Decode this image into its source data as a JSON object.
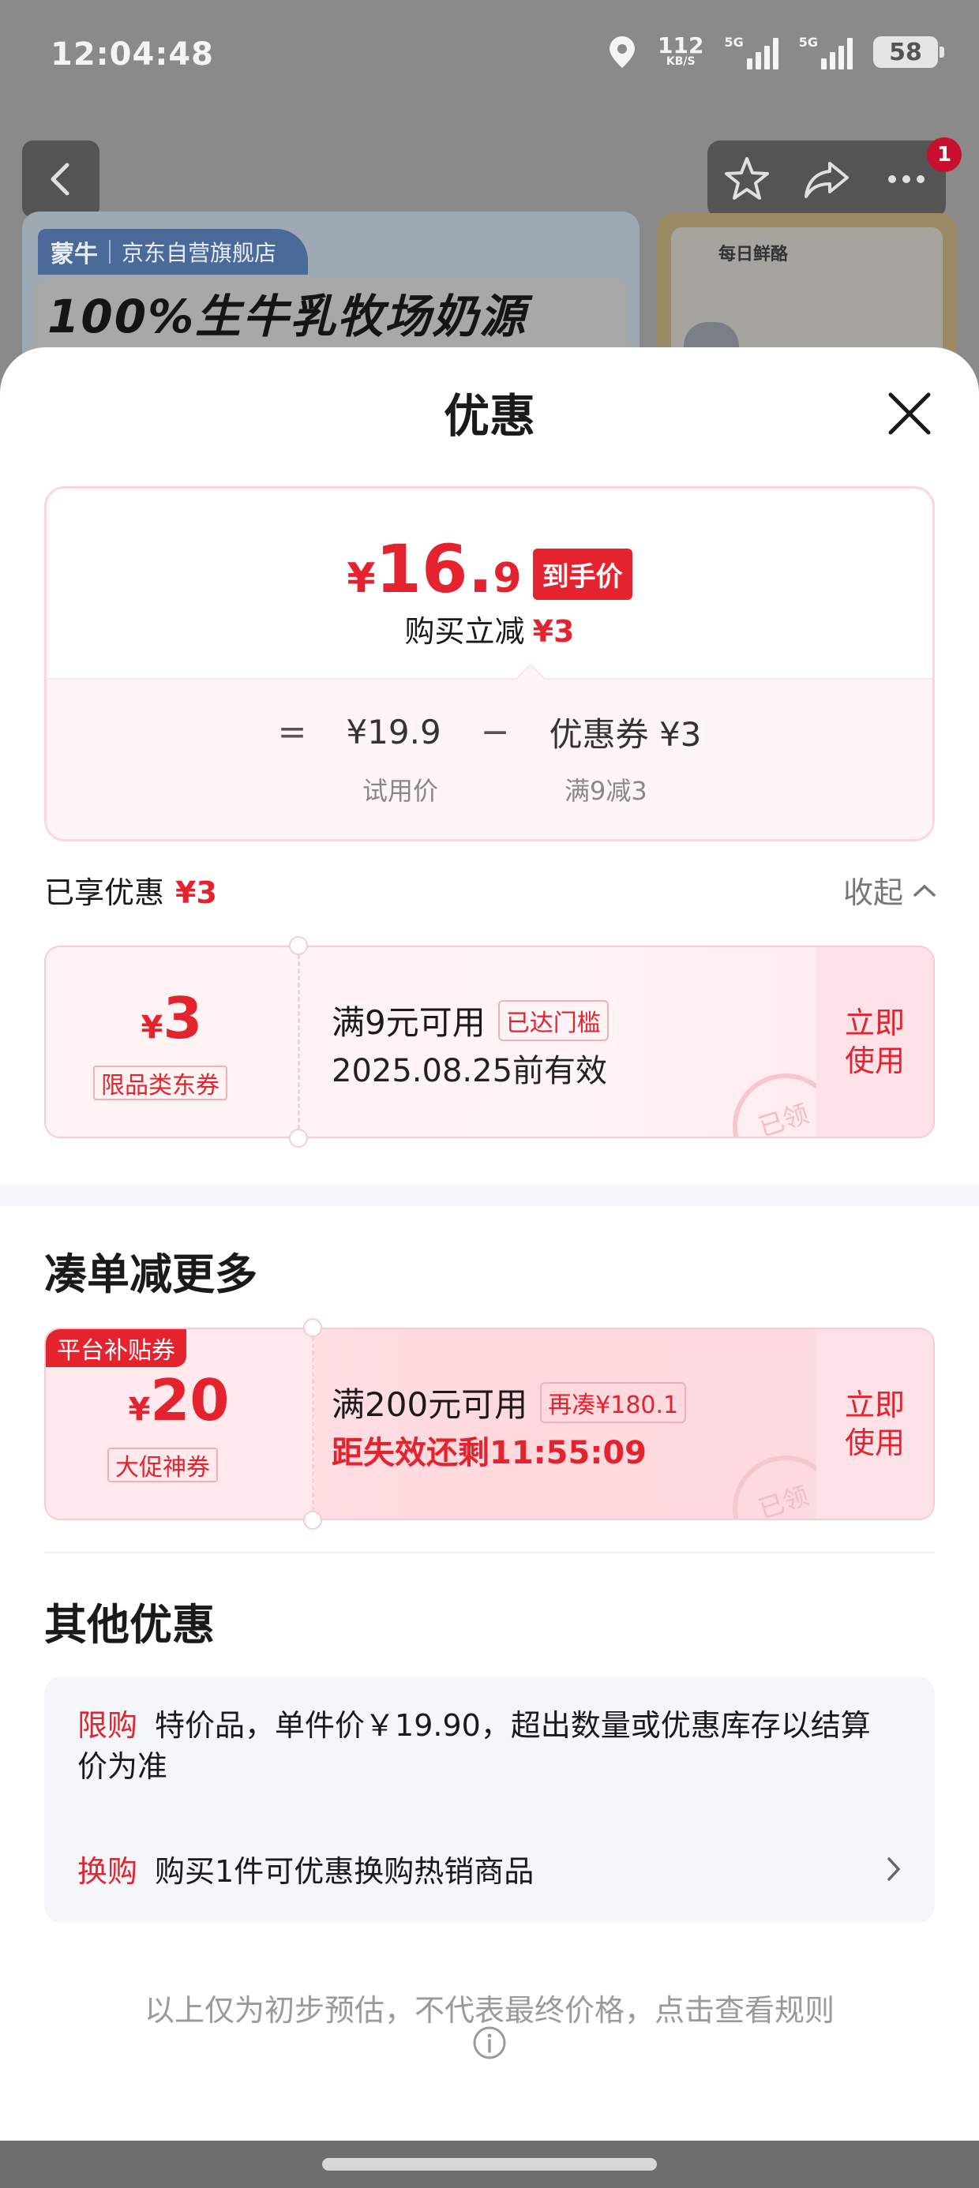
{
  "status_bar": {
    "time": "12:04:48",
    "net_speed": "112",
    "net_unit": "KB/S",
    "sim1": "5G",
    "sim2": "5G",
    "battery": "58"
  },
  "background": {
    "notif_count": "1",
    "banner_brand": "蒙牛",
    "banner_store": "京东自营旗舰店",
    "banner_headline": "100%生牛乳牧场奶源",
    "side_logo": "每日鲜酪"
  },
  "sheet": {
    "title": "优惠",
    "price": {
      "currency": "¥",
      "integer": "16.",
      "decimal": "9",
      "badge": "到手价",
      "sub_label": "购买立减",
      "sub_value": "¥3",
      "eq": "=",
      "trial_price": "¥19.9",
      "minus": "−",
      "coupon_label": "优惠券 ¥3",
      "trial_label": "试用价",
      "coupon_rule": "满9减3"
    },
    "enjoyed": {
      "label": "已享优惠",
      "value": "¥3",
      "collapse": "收起"
    },
    "coupon1": {
      "currency": "¥",
      "amount": "3",
      "type": "限品类东券",
      "condition": "满9元可用",
      "status_tag": "已达门槛",
      "validity": "2025.08.25前有效",
      "use": "立即使用",
      "stamp": "已领"
    },
    "more": {
      "title": "凑单减更多"
    },
    "coupon2": {
      "platform_tag": "平台补贴券",
      "currency": "¥",
      "amount": "20",
      "type": "大促神券",
      "condition": "满200元可用",
      "extra_tag": "再凑¥180.1",
      "countdown": "距失效还剩11:55:09",
      "use": "立即使用",
      "stamp": "已领"
    },
    "other": {
      "title": "其他优惠",
      "row1_key": "限购",
      "row1_text": "特价品，单件价￥19.90，超出数量或优惠库存以结算价为准",
      "row2_key": "换购",
      "row2_text": "购买1件可优惠换购热销商品"
    },
    "disclaimer": "以上仅为初步预估，不代表最终价格，点击查看规则"
  },
  "colors": {
    "accent_red": "#e4232e",
    "soft_pink": "#fff5f6"
  }
}
